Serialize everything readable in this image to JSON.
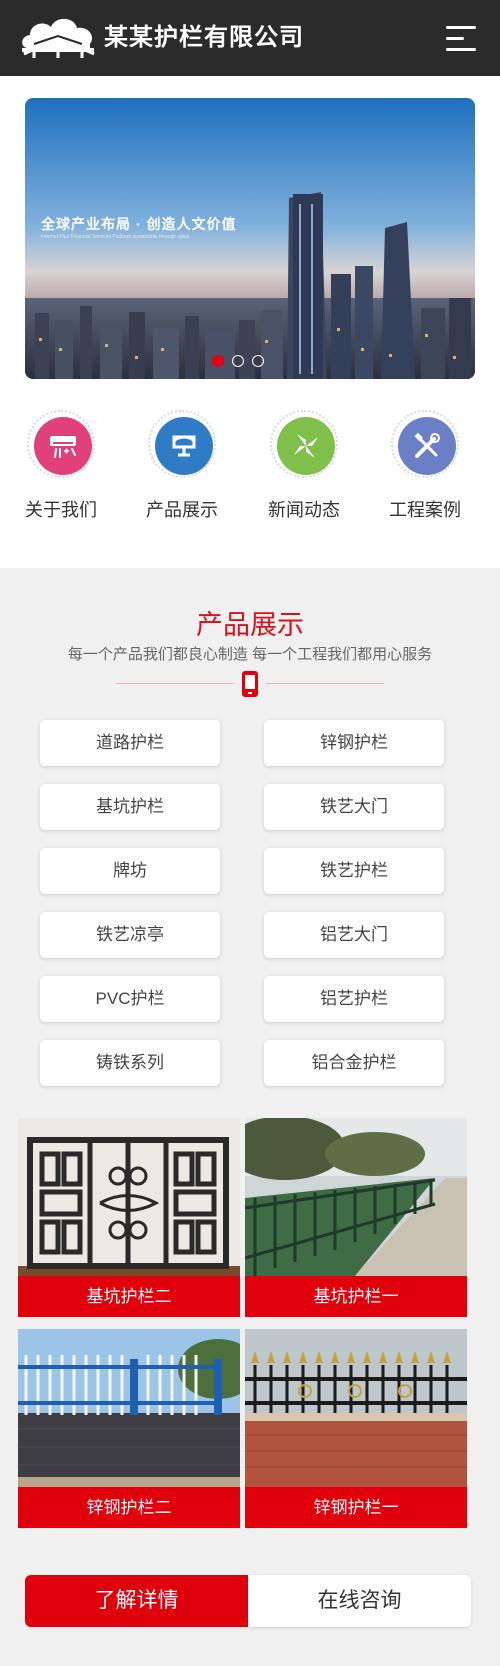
{
  "header": {
    "company_name": "某某护栏有限公司",
    "logo_icon": "cloud-bridge-logo",
    "menu_icon": "hamburger-menu-icon"
  },
  "banner": {
    "headline": "全球产业布局 · 创造人文价值",
    "subline": "Internet Plus Financial Services Platform sustainable through value",
    "slide_count": 3,
    "active_slide": 1,
    "colors": {
      "sky_top": "#2f7ec4",
      "sky_bottom": "#c7d9ec",
      "active_dot": "#e60012"
    }
  },
  "quick_nav": [
    {
      "label": "关于我们",
      "icon": "air-conditioner-icon",
      "color": "#e0417b"
    },
    {
      "label": "产品展示",
      "icon": "monitor-stand-icon",
      "color": "#2f7bc4"
    },
    {
      "label": "新闻动态",
      "icon": "pinwheel-icon",
      "color": "#7fbf4a"
    },
    {
      "label": "工程案例",
      "icon": "tools-icon",
      "color": "#6a7fc6"
    }
  ],
  "products": {
    "title": "产品展示",
    "subtitle": "每一个产品我们都良心制造 每一个工程我们都用心服务",
    "divider_icon": "phone-icon",
    "categories": [
      "道路护栏",
      "锌钢护栏",
      "基坑护栏",
      "铁艺大门",
      "牌坊",
      "铁艺护栏",
      "铁艺凉亭",
      "铝艺大门",
      "PVC护栏",
      "铝艺护栏",
      "铸铁系列",
      "铝合金护栏"
    ],
    "items": [
      {
        "label": "基坑护栏二",
        "image": "wrought-iron-panel"
      },
      {
        "label": "基坑护栏一",
        "image": "roadside-fence"
      },
      {
        "label": "锌钢护栏二",
        "image": "white-blue-fence"
      },
      {
        "label": "锌钢护栏一",
        "image": "spear-top-fence"
      }
    ]
  },
  "cta": {
    "learn_more": "了解详情",
    "consult": "在线咨询"
  },
  "theme": {
    "accent": "#e0000b",
    "header_bg": "#2b2b2b"
  }
}
